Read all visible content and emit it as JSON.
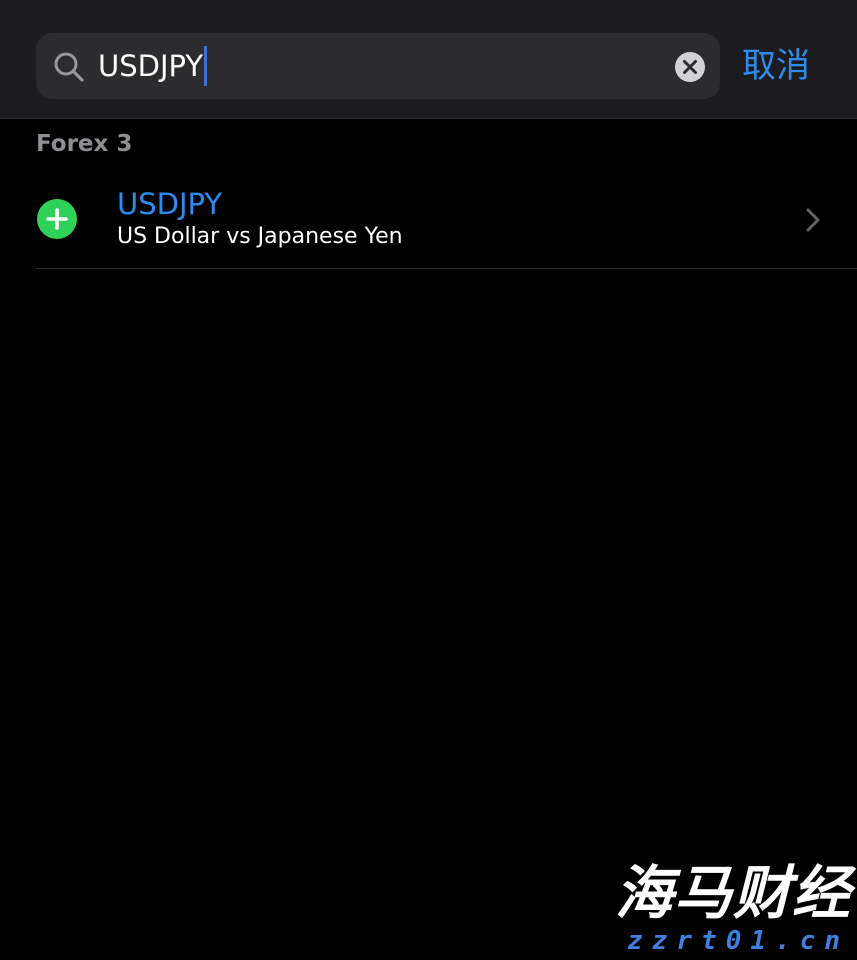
{
  "search": {
    "query": "USDJPY",
    "cancel_label": "取消",
    "icons": {
      "search": "search-icon",
      "clear": "clear-icon"
    }
  },
  "section": {
    "title": "Forex 3"
  },
  "results": [
    {
      "symbol": "USDJPY",
      "name": "US Dollar vs Japanese Yen",
      "icons": {
        "add": "plus-circle-icon",
        "disclosure": "chevron-right-icon"
      }
    }
  ],
  "watermark": {
    "title": "海马财经",
    "url": "zzrt01.cn"
  },
  "colors": {
    "accent": "#2d8cf0",
    "add_green": "#30d158",
    "caret": "#3d6fd9",
    "background": "#000000",
    "search_bar_bg": "#1c1c1e",
    "search_field_bg": "#2c2c2e",
    "secondary_text": "#8e8e93"
  }
}
